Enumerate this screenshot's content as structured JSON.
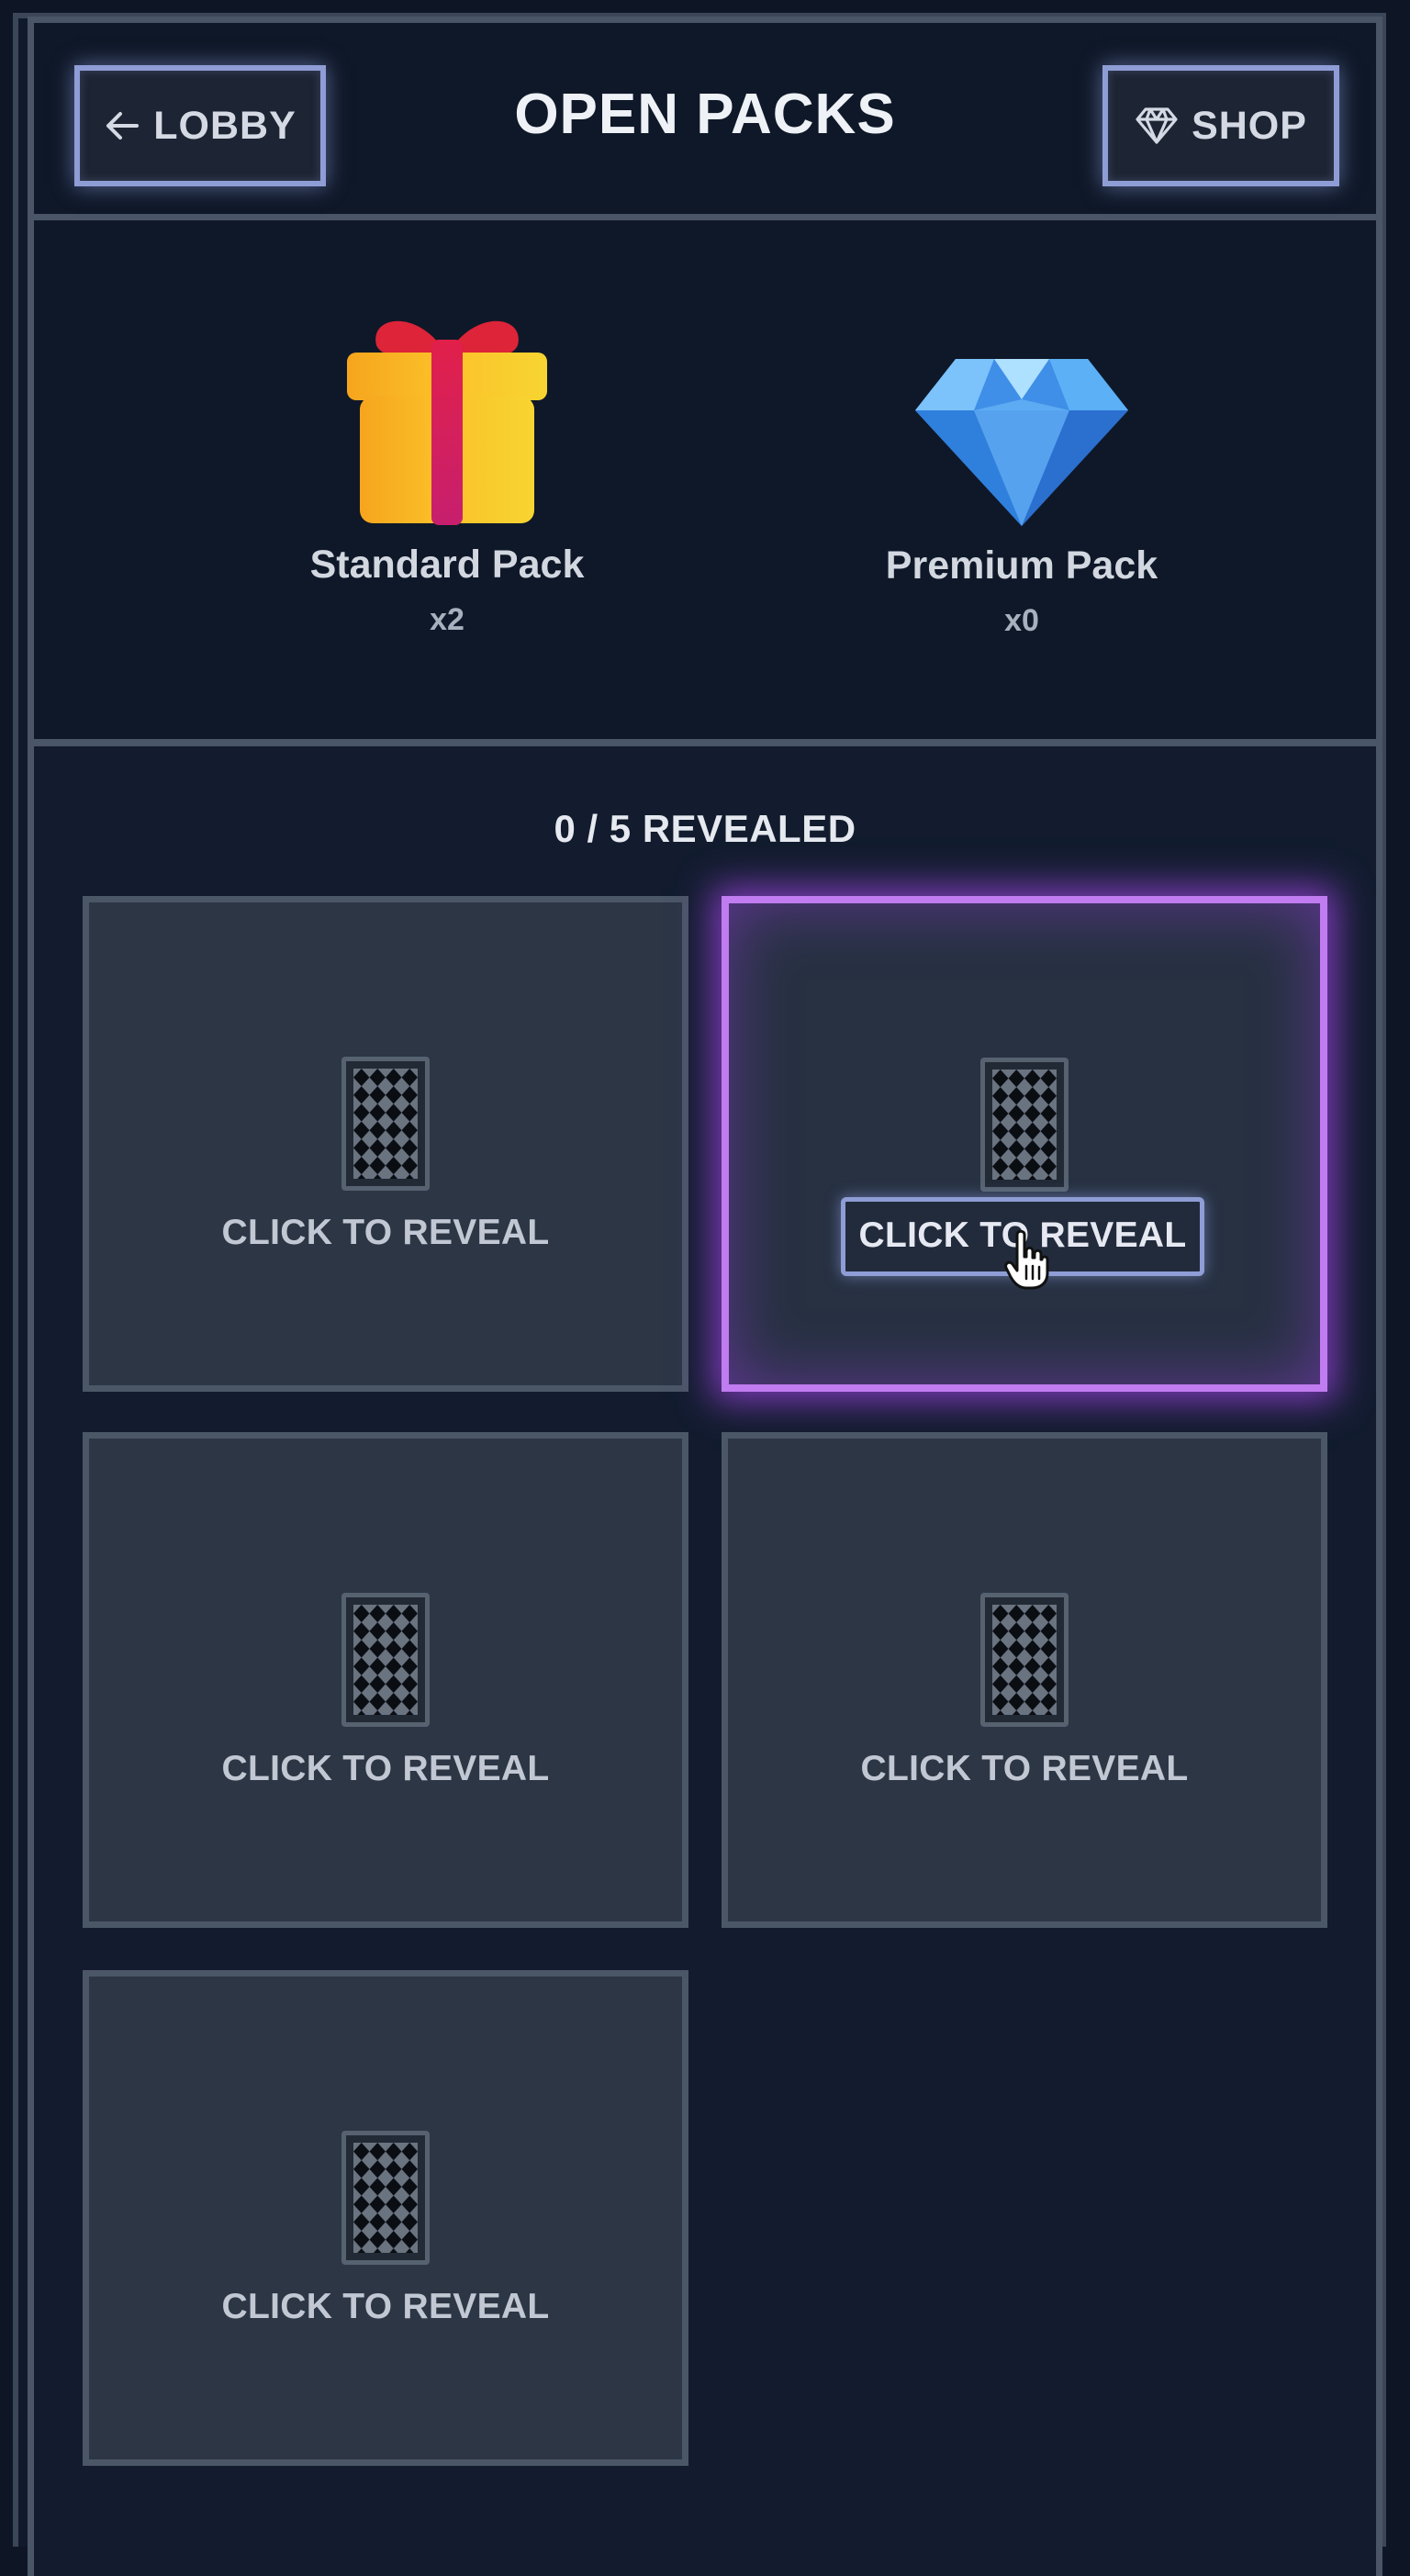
{
  "header": {
    "title": "OPEN PACKS",
    "lobby_label": "LOBBY",
    "shop_label": "SHOP",
    "lobby_icon": "arrow-left-icon",
    "shop_icon": "diamond-icon"
  },
  "packs": [
    {
      "name": "Standard Pack",
      "count": "x2",
      "icon": "gift-icon"
    },
    {
      "name": "Premium Pack",
      "count": "x0",
      "icon": "gem-icon"
    }
  ],
  "reveal": {
    "status": "0 / 5 REVEALED",
    "revealed": 0,
    "total": 5,
    "cards": [
      {
        "label": "CLICK TO REVEAL",
        "state": "hidden"
      },
      {
        "label": "CLICK TO REVEAL",
        "state": "hover"
      },
      {
        "label": "CLICK TO REVEAL",
        "state": "hidden"
      },
      {
        "label": "CLICK TO REVEAL",
        "state": "hidden"
      },
      {
        "label": "CLICK TO REVEAL",
        "state": "hidden"
      }
    ]
  },
  "colors": {
    "background": "#0e1626",
    "panel_border": "#4a5667",
    "button_glow": "#8f9dd6",
    "active_card_glow": "#c07cf0",
    "card_slot": "#2c3645"
  }
}
